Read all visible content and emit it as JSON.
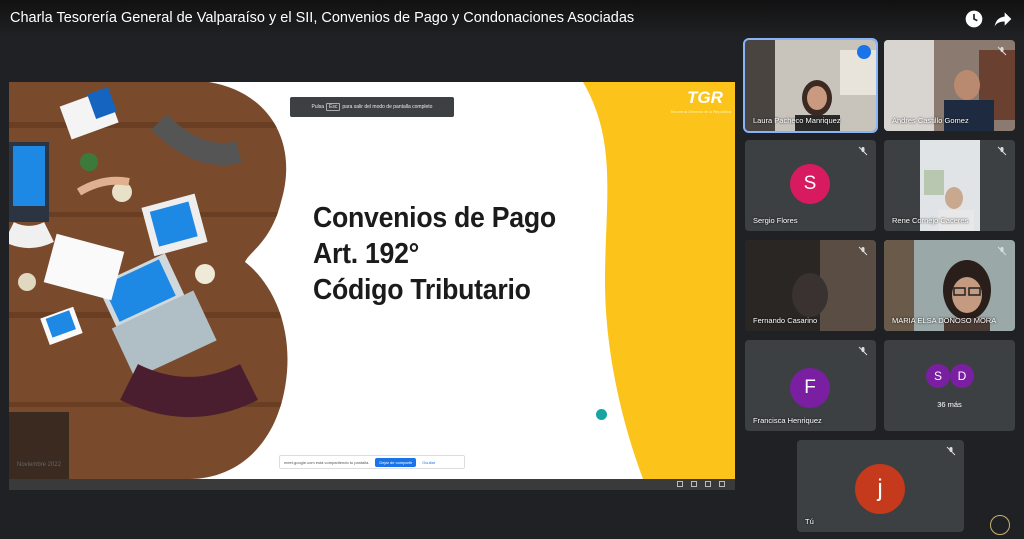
{
  "video": {
    "title": "Charla Tesorería General de Valparaíso y el SII, Convenios de Pago y Condonaciones Asociadas"
  },
  "icons": {
    "watch_later": "clock-icon",
    "share": "share-icon"
  },
  "slide": {
    "title_lines": [
      "Convenios de Pago",
      "Art. 192°",
      "Código Tributario"
    ],
    "logo_text": "TGR",
    "logo_subtitle": "Tesorería General de la República",
    "footer_text": "Noviembre 2022",
    "fullscreen_hint": {
      "prefix": "Pulsa",
      "key": "Esc",
      "suffix": "para salir del modo de pantalla completo"
    },
    "share_bar": {
      "message": "meet.google.com está compartiendo tu pantalla.",
      "stop_label": "Dejar de compartir",
      "hide_label": "Ocultar"
    },
    "colors": {
      "accent_yellow": "#fcc31a",
      "title": "#1b1b1b"
    }
  },
  "participants": [
    {
      "name": "Laura Pacheco Manriquez",
      "type": "video",
      "speaking": true
    },
    {
      "name": "Andres Castillo Gomez",
      "type": "video",
      "muted": true
    },
    {
      "name": "Sergio Flores",
      "type": "avatar",
      "initial": "S",
      "color": "#d81b60",
      "muted": true
    },
    {
      "name": "Rene Cornejo Caceres",
      "type": "video",
      "muted": true
    },
    {
      "name": "Fernando Casarino",
      "type": "video",
      "muted": true
    },
    {
      "name": "MARIA ELSA DONOSO MORA",
      "type": "video",
      "muted": true
    },
    {
      "name": "Francisca Henriquez",
      "type": "avatar",
      "initial": "F",
      "color": "#7b1fa2",
      "muted": true
    },
    {
      "name": "",
      "type": "more",
      "initials": [
        "S",
        "D"
      ],
      "colors": [
        "#7b1fa2",
        "#7b1fa2"
      ],
      "count": "36 más"
    },
    {
      "name": "Tú",
      "type": "avatar",
      "initial": "j",
      "color": "#c5391c",
      "muted": true
    }
  ]
}
